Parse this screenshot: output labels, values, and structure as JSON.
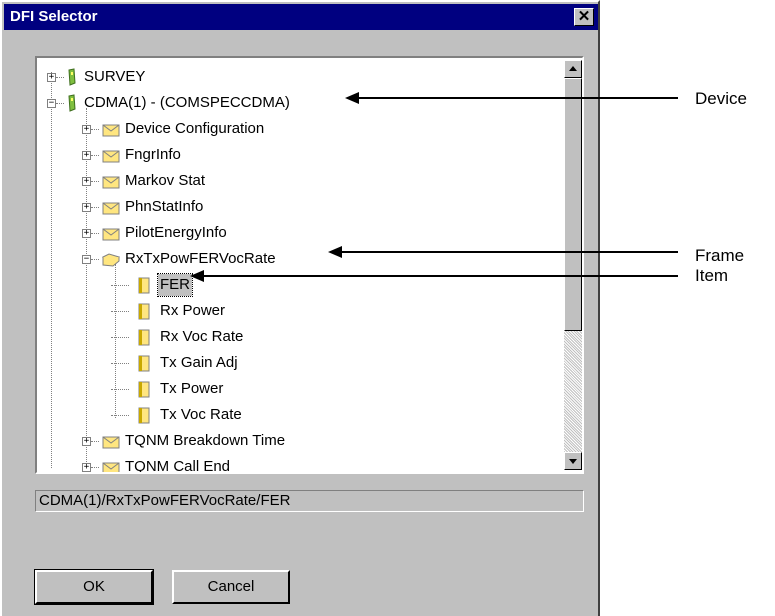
{
  "window": {
    "title": "DFI Selector",
    "close_glyph": "✕"
  },
  "tree": {
    "expander_plus": "+",
    "expander_minus": "−",
    "nodes": [
      {
        "label": "SURVEY",
        "icon": "device-icon"
      },
      {
        "label": "CDMA(1) - (COMSPECCDMA)",
        "icon": "device-icon"
      },
      {
        "label": "Device Configuration",
        "icon": "folder-closed-icon"
      },
      {
        "label": "FngrInfo",
        "icon": "folder-closed-icon"
      },
      {
        "label": "Markov Stat",
        "icon": "folder-closed-icon"
      },
      {
        "label": "PhnStatInfo",
        "icon": "folder-closed-icon"
      },
      {
        "label": "PilotEnergyInfo",
        "icon": "folder-closed-icon"
      },
      {
        "label": "RxTxPowFERVocRate",
        "icon": "folder-open-icon"
      },
      {
        "label": "FER",
        "icon": "item-icon",
        "selected": true
      },
      {
        "label": "Rx Power",
        "icon": "item-icon"
      },
      {
        "label": "Rx Voc Rate",
        "icon": "item-icon"
      },
      {
        "label": "Tx Gain Adj",
        "icon": "item-icon"
      },
      {
        "label": "Tx Power",
        "icon": "item-icon"
      },
      {
        "label": "Tx Voc Rate",
        "icon": "item-icon"
      },
      {
        "label": "TQNM Breakdown Time",
        "icon": "folder-closed-icon"
      },
      {
        "label": "TQNM Call End",
        "icon": "folder-closed-icon"
      }
    ]
  },
  "path": {
    "value": "CDMA(1)/RxTxPowFERVocRate/FER"
  },
  "buttons": {
    "ok_label": "OK",
    "cancel_label": "Cancel"
  },
  "annotations": {
    "device_label": "Device",
    "frame_label": "Frame",
    "item_label": "Item"
  },
  "colors": {
    "titlebar": "#000080",
    "dialog_bg": "#c0c0c0",
    "folder": "#ffe680",
    "device": "#7fbf3f"
  }
}
